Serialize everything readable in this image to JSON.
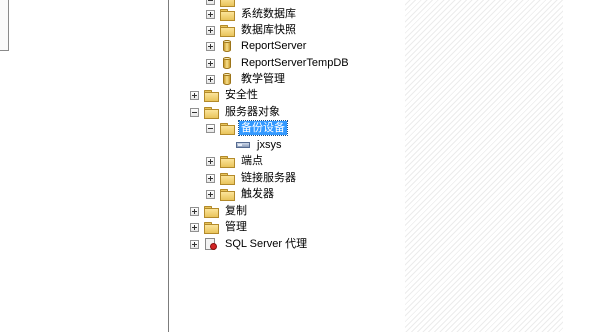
{
  "object_explorer": {
    "nodes": [
      {
        "id": "truncated-db",
        "label": "",
        "expander": "minus",
        "icon": "folder-icon"
      },
      {
        "id": "system-databases",
        "label": "系统数据库",
        "expander": "plus",
        "icon": "folder-icon"
      },
      {
        "id": "database-snapshots",
        "label": "数据库快照",
        "expander": "plus",
        "icon": "folder-icon"
      },
      {
        "id": "reportserver",
        "label": "ReportServer",
        "expander": "plus",
        "icon": "database-icon"
      },
      {
        "id": "reportservertempdb",
        "label": "ReportServerTempDB",
        "expander": "plus",
        "icon": "database-icon"
      },
      {
        "id": "teaching-management",
        "label": "教学管理",
        "expander": "plus",
        "icon": "database-icon"
      },
      {
        "id": "security",
        "label": "安全性",
        "expander": "plus",
        "icon": "folder-icon"
      },
      {
        "id": "server-objects",
        "label": "服务器对象",
        "expander": "minus",
        "icon": "folder-icon"
      },
      {
        "id": "backup-devices",
        "label": "备份设备",
        "expander": "minus",
        "icon": "folder-icon",
        "selected": true
      },
      {
        "id": "jxsys",
        "label": "jxsys",
        "expander": "none",
        "icon": "backup-device-icon"
      },
      {
        "id": "endpoints",
        "label": "端点",
        "expander": "plus",
        "icon": "folder-icon"
      },
      {
        "id": "linked-servers",
        "label": "链接服务器",
        "expander": "plus",
        "icon": "folder-icon"
      },
      {
        "id": "triggers",
        "label": "触发器",
        "expander": "plus",
        "icon": "folder-icon"
      },
      {
        "id": "replication",
        "label": "复制",
        "expander": "plus",
        "icon": "folder-icon"
      },
      {
        "id": "management",
        "label": "管理",
        "expander": "plus",
        "icon": "folder-icon"
      },
      {
        "id": "sql-server-agent",
        "label": "SQL Server 代理",
        "expander": "plus",
        "icon": "sql-agent-icon"
      }
    ]
  },
  "colors": {
    "selection": "#3399ff",
    "folder": "#f2d27a",
    "pane_border": "#7c7c7c"
  }
}
